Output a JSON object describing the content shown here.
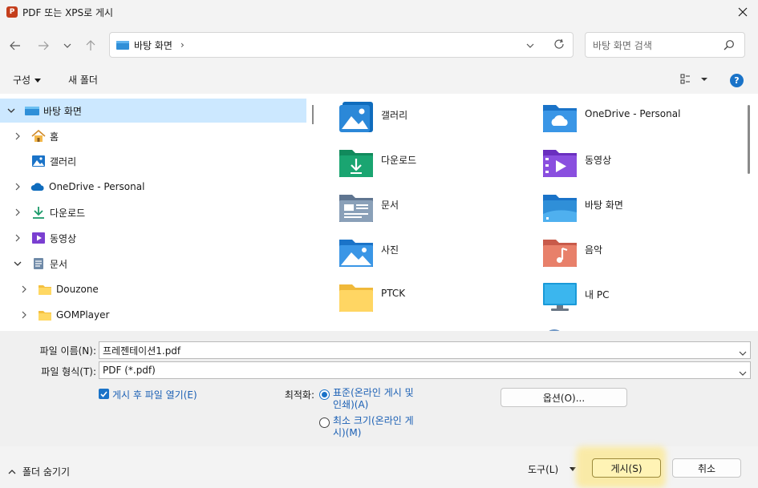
{
  "titlebar": {
    "app_icon": "P",
    "title": "PDF 또는 XPS로 게시",
    "close_icon": "close-icon"
  },
  "nav": {
    "back_icon": "arrow-left-icon",
    "forward_icon": "arrow-right-icon",
    "recent_icon": "chevron-down-icon",
    "up_icon": "arrow-up-icon",
    "address": "바탕 화면",
    "address_sep": "›",
    "search_placeholder": "바탕 화면 검색"
  },
  "toolbar": {
    "organize": "구성",
    "new_folder": "새 폴더",
    "help": "?"
  },
  "tree": [
    {
      "label": "바탕 화면",
      "icon": "desktop-folder-icon",
      "expanded": true,
      "selected": true
    },
    {
      "label": "홈",
      "icon": "home-icon"
    },
    {
      "label": "갤러리",
      "icon": "gallery-icon"
    },
    {
      "label": "OneDrive - Personal",
      "icon": "onedrive-icon"
    },
    {
      "label": "다운로드",
      "icon": "download-icon"
    },
    {
      "label": "동영상",
      "icon": "video-icon"
    },
    {
      "label": "문서",
      "icon": "documents-icon",
      "expanded": true
    },
    {
      "label": "Douzone",
      "icon": "folder-icon"
    },
    {
      "label": "GOMPlayer",
      "icon": "folder-icon"
    }
  ],
  "items": [
    {
      "label": "갤러리",
      "icon": "gallery-icon"
    },
    {
      "label": "OneDrive - Personal",
      "icon": "onedrive-folder-icon"
    },
    {
      "label": "다운로드",
      "icon": "download-folder-icon"
    },
    {
      "label": "동영상",
      "icon": "video-folder-icon"
    },
    {
      "label": "문서",
      "icon": "documents-folder-icon"
    },
    {
      "label": "바탕 화면",
      "icon": "desktop-folder-icon"
    },
    {
      "label": "사진",
      "icon": "pictures-folder-icon"
    },
    {
      "label": "음악",
      "icon": "music-folder-icon"
    },
    {
      "label": "PTCK",
      "icon": "folder-icon"
    },
    {
      "label": "내 PC",
      "icon": "pc-icon"
    }
  ],
  "form": {
    "filename_label": "파일 이름(N):",
    "filename_value": "프레젠테이션1.pdf",
    "filetype_label": "파일 형식(T):",
    "filetype_value": "PDF (*.pdf)",
    "open_after_label": "게시 후 파일 열기(E)",
    "optimize_label": "최적화:",
    "opt_standard_line1": "표준(온라인 게시 및",
    "opt_standard_line2": "인쇄)(A)",
    "opt_min_line1": "최소 크기(온라인 게",
    "opt_min_line2": "시)(M)",
    "options_button": "옵션(O)..."
  },
  "footer": {
    "hide_folders": "폴더 숨기기",
    "tools": "도구(L)",
    "publish": "게시(S)",
    "cancel": "취소"
  }
}
